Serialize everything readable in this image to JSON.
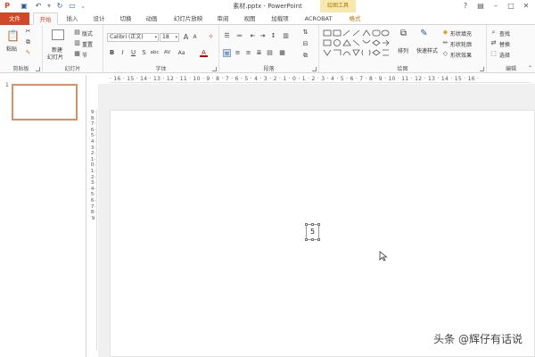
{
  "window": {
    "title": "素材.pptx - PowerPoint",
    "context_tab_group": "绘图工具",
    "qat_icons": [
      "powerpoint-logo-icon",
      "save-icon",
      "undo-icon",
      "redo-icon",
      "start-presentation-icon",
      "customize-qat-icon"
    ],
    "controls": [
      "help-icon",
      "ribbon-display-icon",
      "minimize-icon",
      "maximize-icon",
      "close-icon"
    ]
  },
  "tabs": [
    "文件",
    "开始",
    "插入",
    "设计",
    "切换",
    "动画",
    "幻灯片放映",
    "审阅",
    "视图",
    "加载项",
    "ACROBAT",
    "格式"
  ],
  "active_tab": "开始",
  "ribbon": {
    "clipboard": {
      "label": "剪贴板",
      "paste": "粘贴"
    },
    "slides": {
      "label": "幻灯片",
      "new_slide": "新建",
      "new_slide2": "幻灯片",
      "layout": "版式",
      "reset": "重置",
      "section": "节"
    },
    "font": {
      "label": "字体",
      "font_name": "Calibri (正文)",
      "font_size": "18",
      "grow": "A",
      "shrink": "A",
      "bold": "B",
      "italic": "I",
      "underline": "U",
      "strike": "S",
      "shadow": "abc",
      "spacing": "AV",
      "case": "Aa"
    },
    "paragraph": {
      "label": "段落"
    },
    "drawing": {
      "label": "绘图",
      "arrange": "排列",
      "quick_styles": "快速样式",
      "shape_fill": "形状填充",
      "shape_outline": "形状轮廓",
      "shape_effects": "形状效果"
    },
    "editing": {
      "label": "编辑",
      "find": "查找",
      "replace": "替换",
      "select": "选择"
    }
  },
  "ruler_h": "· 16 · 15 · 14 · 13 · 12 · 11 · 10 · 9 · 8 · 7 · 6 · 5 · 4 · 3 · 2 · 1 · 0 · 1 · 2 · 3 · 4 · 5 · 6 · 7 · 8 · 9 · 10 · 11 · 12 · 13 · 14 · 15 · 16 ·",
  "ruler_v": "9·8·7·6·5·4·3·2·1·0·1·2·3·4·5·6·7·8·9",
  "slides_panel": {
    "slide_number": "1"
  },
  "slide": {
    "textbox_text": "5"
  },
  "watermark": "头条 @辉仔有话说"
}
